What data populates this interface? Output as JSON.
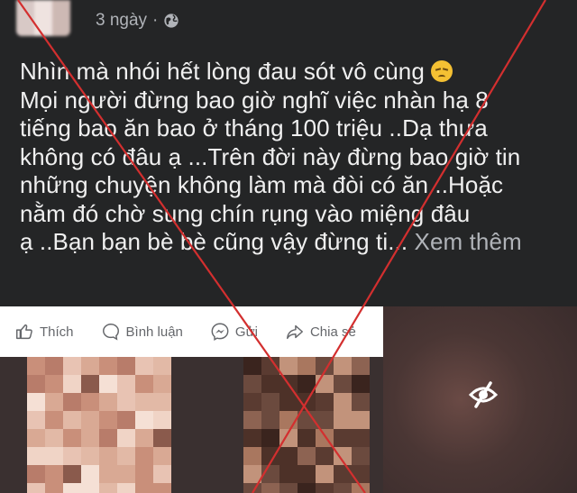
{
  "post": {
    "time": "3 ngày",
    "separator": "·",
    "lines": [
      "Nhìn mà nhói hết lòng đau sót vô cùng",
      "Mọi người đừng bao giờ nghĩ việc nhàn hạ 8",
      "tiếng bao ăn bao ở tháng 100 triệu ..Dạ thưa",
      "không có đâu ạ ...Trên đời này đừng bao giờ tin",
      "những chuyện không làm mà đòi có ăn ..Hoặc",
      "nằm đó chờ sung chín rụng vào miệng đâu",
      "ạ ..Bạn bạn bè bè cũng vậy đừng ti..."
    ],
    "see_more": "Xem thêm"
  },
  "actions": {
    "like": "Thích",
    "comment": "Bình luận",
    "send": "Gửi",
    "share": "Chia sẻ"
  },
  "icons": {
    "privacy": "globe-icon",
    "hidden_media": "eye-slash-icon",
    "emoji": "pensive-face-icon"
  },
  "colors": {
    "background": "#242526",
    "text": "#f0f0f0",
    "muted": "#b0b3b8",
    "action_bar": "#ffffff",
    "strike_red": "#d32f2f"
  }
}
